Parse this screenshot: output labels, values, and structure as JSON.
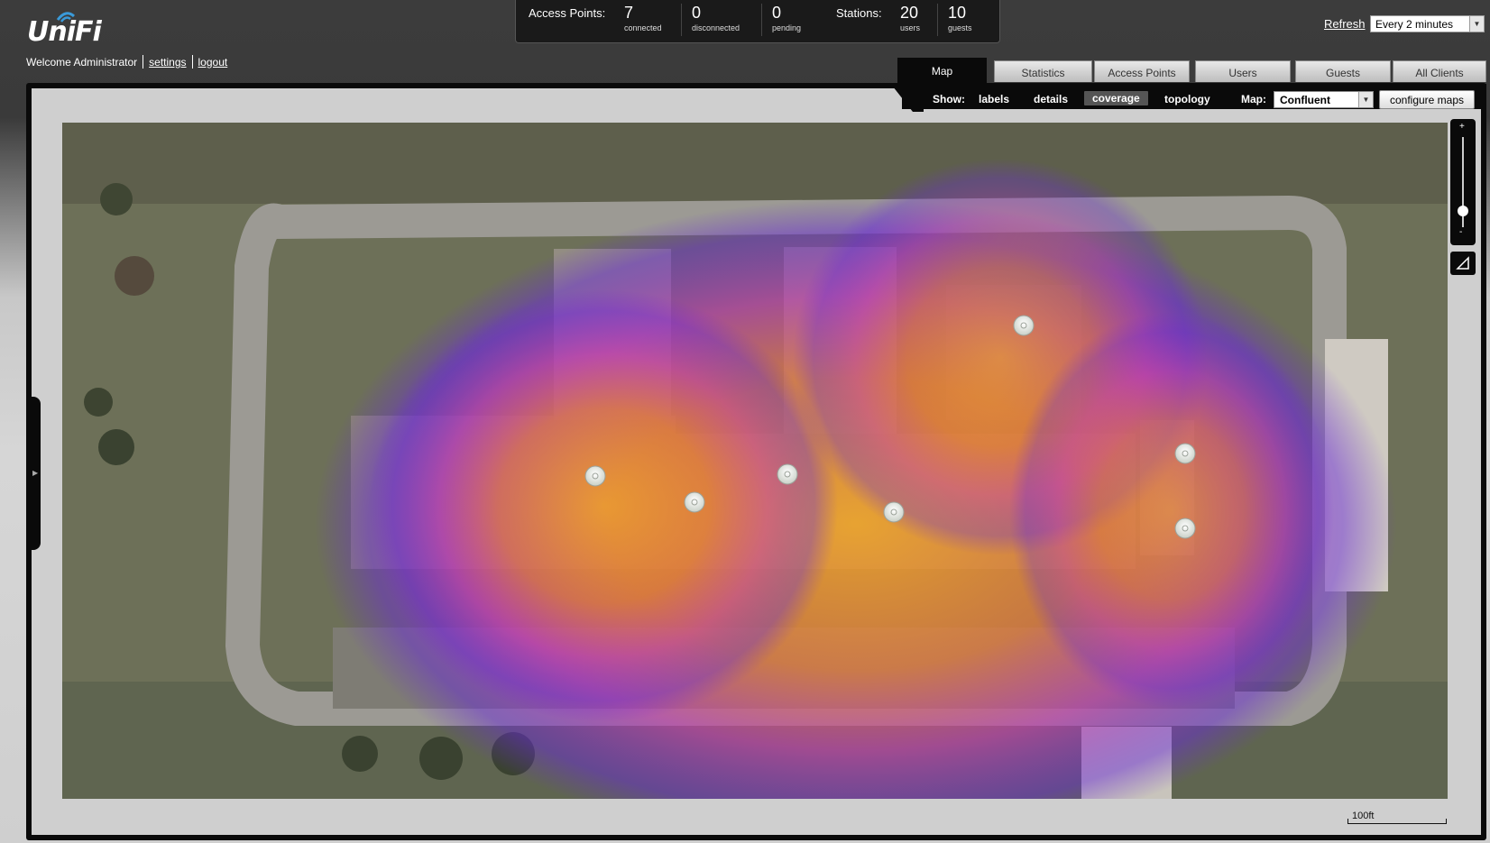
{
  "header": {
    "brand": "UniFi",
    "welcome": "Welcome Administrator",
    "settings_link": "settings",
    "logout_link": "logout"
  },
  "stats": {
    "access_points_label": "Access Points:",
    "connected": {
      "value": "7",
      "label": "connected"
    },
    "disconnected": {
      "value": "0",
      "label": "disconnected"
    },
    "pending": {
      "value": "0",
      "label": "pending"
    },
    "stations_label": "Stations:",
    "users": {
      "value": "20",
      "label": "users"
    },
    "guests": {
      "value": "10",
      "label": "guests"
    }
  },
  "refresh": {
    "link": "Refresh",
    "selected": "Every 2 minutes"
  },
  "tabs": [
    {
      "label": "Map",
      "active": true
    },
    {
      "label": "Statistics"
    },
    {
      "label": "Access Points"
    },
    {
      "label": "Users"
    },
    {
      "label": "Guests"
    },
    {
      "label": "All Clients"
    }
  ],
  "toolbar": {
    "show_label": "Show:",
    "labels": "labels",
    "details": "details",
    "coverage": "coverage",
    "topology": "topology",
    "map_label": "Map:",
    "map_selected": "Confluent",
    "configure": "configure maps"
  },
  "map": {
    "view": "coverage",
    "access_point_count": 7,
    "scale_label": "100ft",
    "zoom_plus": "+",
    "zoom_minus": "-"
  },
  "colors": {
    "heat_core": "#f5a623",
    "heat_mid": "#c03fb0",
    "heat_edge": "#6a2bd6"
  }
}
